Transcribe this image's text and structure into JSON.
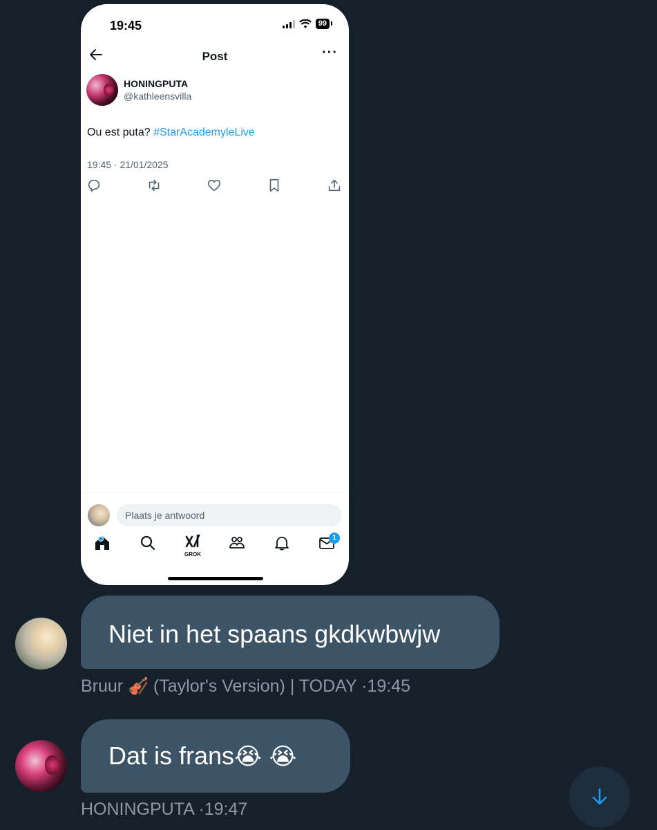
{
  "phone": {
    "status_time": "19:45",
    "battery": "99",
    "nav_title": "Post",
    "author_name": "HONINGPUTA",
    "author_handle": "@kathleensvilla",
    "post_text": "Ou est puta? ",
    "post_hashtag": "#StarAcademyleLive",
    "post_meta": "19:45 · 21/01/2025",
    "actions": [
      "reply-icon",
      "retweet-icon",
      "like-icon",
      "bookmark-icon",
      "share-icon"
    ],
    "reply_placeholder": "Plaats je antwoord",
    "tabs": [
      "home-icon",
      "search-icon",
      "grok-icon",
      "communities-icon",
      "notifications-icon",
      "messages-icon"
    ],
    "grok_label": "GROK",
    "messages_badge": "1"
  },
  "chat": {
    "messages": [
      {
        "text": "Niet in het spaans gkdkwbwjw",
        "meta_name": "Bruur",
        "meta_emoji": "🎻",
        "meta_rest": " (Taylor's Version) | TODAY ·19:45"
      },
      {
        "text": "Dat is frans",
        "emoji": "😭 😭",
        "meta": "HONINGPUTA ·19:47"
      }
    ]
  },
  "colors": {
    "background": "#15202b",
    "bubble": "#3d5466",
    "accent": "#1d9bf0",
    "meta_text": "#8b98a5"
  }
}
